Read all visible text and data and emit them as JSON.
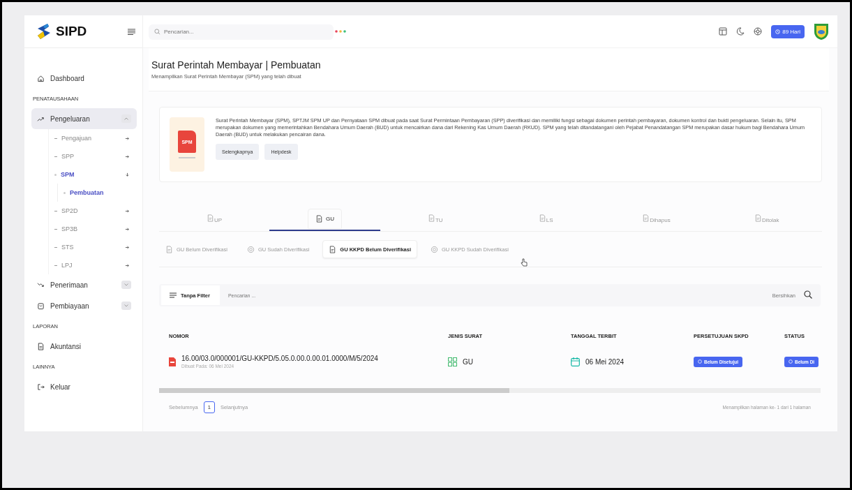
{
  "logo": {
    "text": "SIPD"
  },
  "header": {
    "search_placeholder": "Pencarian...",
    "days_button": "89 Hari"
  },
  "sidebar": {
    "menu": [
      {
        "kind": "link",
        "label": "Dashboard",
        "selected": false
      },
      {
        "kind": "section",
        "label": "PENATAUSAHAAN"
      },
      {
        "kind": "group",
        "label": "Pengeluaran",
        "selected": true,
        "expanded": true,
        "children": [
          {
            "label": "Pengajuan",
            "selected": false,
            "expanded": false
          },
          {
            "label": "SPP",
            "selected": false,
            "expanded": false
          },
          {
            "label": "SPM",
            "selected": true,
            "expanded": true,
            "children": [
              {
                "label": "Pembuatan",
                "selected": true
              }
            ]
          },
          {
            "label": "SP2D",
            "selected": false,
            "expanded": false
          },
          {
            "label": "SP3B",
            "selected": false,
            "expanded": false
          },
          {
            "label": "STS",
            "selected": false,
            "expanded": false
          },
          {
            "label": "LPJ",
            "selected": false,
            "expanded": false
          }
        ]
      },
      {
        "kind": "group",
        "label": "Penerimaan",
        "selected": false,
        "expanded": false
      },
      {
        "kind": "group",
        "label": "Pembiayaan",
        "selected": false,
        "expanded": false
      },
      {
        "kind": "section",
        "label": "LAPORAN"
      },
      {
        "kind": "link",
        "label": "Akuntansi",
        "selected": false
      },
      {
        "kind": "section",
        "label": "LAINNYA"
      },
      {
        "kind": "link",
        "label": "Keluar",
        "selected": false
      }
    ]
  },
  "page": {
    "title": "Surat Perintah Membayar | Pembuatan",
    "subtitle": "Menampilkan Surat Perintah Membayar (SPM) yang telah dibuat"
  },
  "info": {
    "icon_label": "SPM",
    "text": "Surat Perintah Membayar (SPM), SPTJM SPM UP dan Pernyataan SPM dibuat pada saat Surat Permintaan Pembayaran (SPP) diverifikasi dan memiliki fungsi sebagai dokumen perintah pembayaran, dokumen kontrol dan bukti pengeluaran. Selain itu, SPM merupakan dokumen yang memerintahkan Bendahara Umum Daerah (BUD) untuk mencairkan dana dari Rekening Kas Umum Daerah (RKUD). SPM yang telah ditandatangani oleh Pejabat Penandatangan SPM merupakan dasar hukum bagi Bendahara Umum Daerah (BUD) untuk melakukan pencairan dana.",
    "buttons": [
      "Selengkapnya",
      "Helpdesk"
    ]
  },
  "tabs": [
    {
      "label": "UP",
      "selected": false
    },
    {
      "label": "GU",
      "selected": true
    },
    {
      "label": "TU",
      "selected": false
    },
    {
      "label": "LS",
      "selected": false
    },
    {
      "label": "Dihapus",
      "selected": false
    },
    {
      "label": "Ditolak",
      "selected": false
    }
  ],
  "subtabs": [
    {
      "label": "GU Belum Diverifikasi",
      "selected": false
    },
    {
      "label": "GU Sudah Diverifikasi",
      "selected": false
    },
    {
      "label": "GU KKPD Belum Diverifikasi",
      "selected": true
    },
    {
      "label": "GU KKPD Sudah Diverifikasi",
      "selected": false
    }
  ],
  "filter": {
    "button": "Tanpa Filter",
    "placeholder": "Pencarian ...",
    "clear": "Bersihkan"
  },
  "table": {
    "columns": [
      "NOMOR",
      "JENIS SURAT",
      "TANGGAL TERBIT",
      "PERSETUJUAN SKPD",
      "STATUS"
    ],
    "rows": [
      {
        "nomor": "16.00/03.0/000001/GU-KKPD/5.05.0.00.0.00.01.0000/M/5/2024",
        "created": "Dibuat Pada: 06 Mei 2024",
        "jenis": "GU",
        "tanggal": "06 Mei 2024",
        "persetujuan": "Belum Disetujui",
        "status": "Belum Di"
      }
    ]
  },
  "pagination": {
    "prev": "Sebelumnya",
    "page": "1",
    "next": "Selanjutnya",
    "info": "Menampilkan halaman ke- 1 dari 1 halaman"
  }
}
